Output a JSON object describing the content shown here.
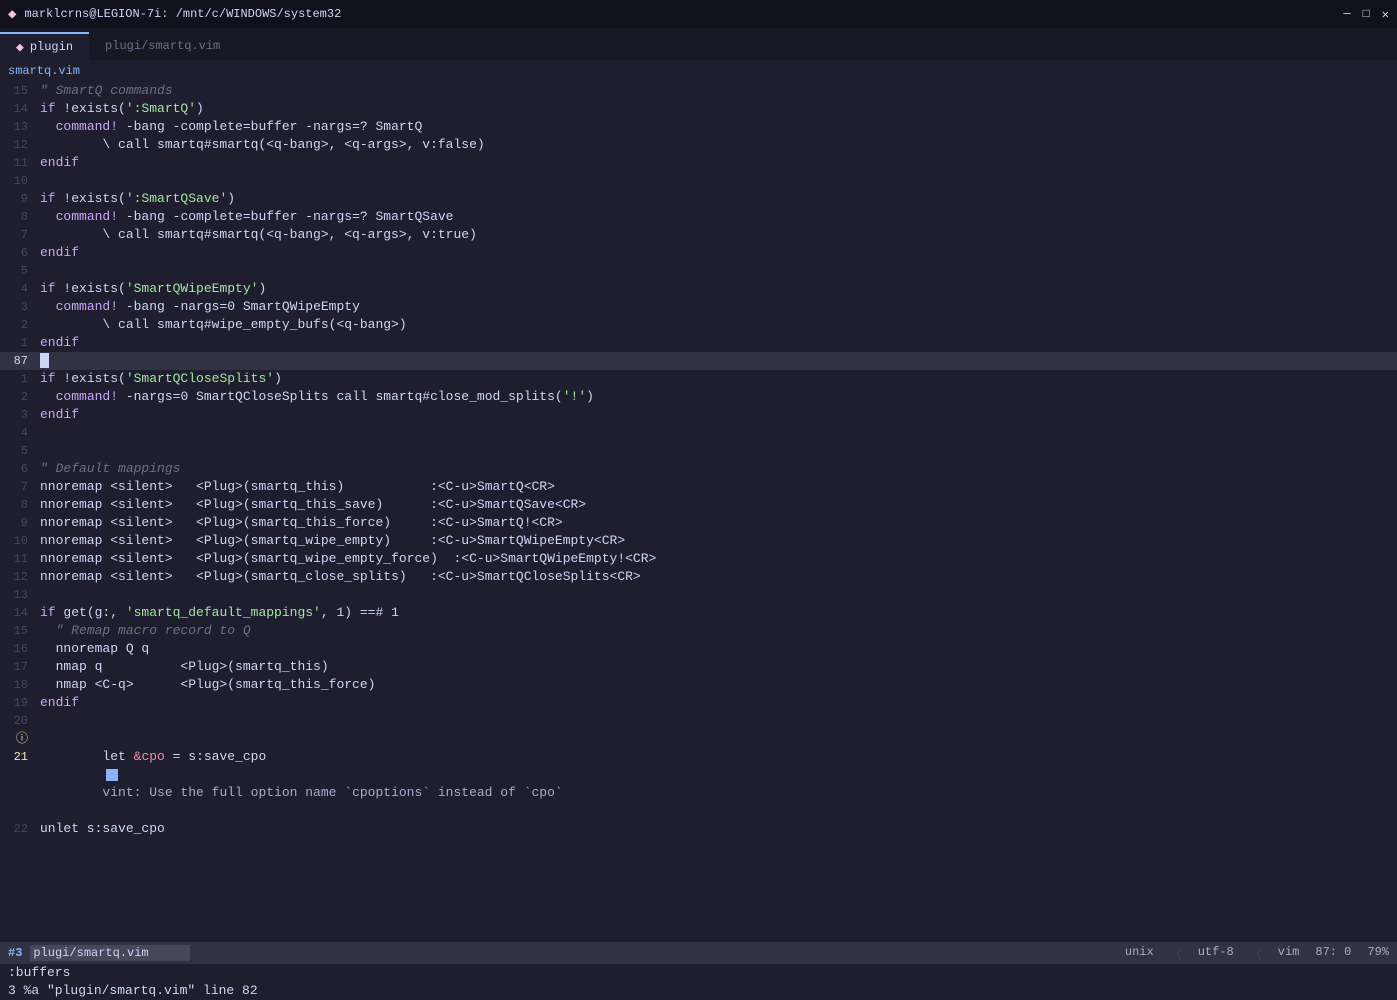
{
  "titlebar": {
    "title": "marklcrns@LEGION-7i: /mnt/c/WINDOWS/system32",
    "icon": "◆",
    "minimize": "─",
    "maximize": "□",
    "close": "✕"
  },
  "tabs": [
    {
      "label": "plugin",
      "icon": "◆",
      "active": true
    },
    {
      "label": "plugi/smartq.vim",
      "icon": "",
      "active": false
    }
  ],
  "filename": "smartq.vim",
  "status_bar": {
    "mode": "#3",
    "file": "plugi/smartq.vim",
    "unix": "unix",
    "encoding": "utf-8",
    "filetype": "vim",
    "position": "87: 0",
    "percent": "79%"
  },
  "cmdline": {
    "buffers_label": ":buffers",
    "buf_line": "  3 %a    \"plugin/smartq.vim\"             line 82"
  },
  "warning_line": {
    "text": "● vint: Use the full option name `cpoptions` instead of `cpo`"
  },
  "lines": [
    {
      "num": "15",
      "content": "\" <span class=\"cm\"> SmartQ commands</span>"
    },
    {
      "num": "14",
      "content": "<span class=\"kw\">if</span> !exists(<span class=\"str\">':SmartQ'</span>)"
    },
    {
      "num": "13",
      "content": "  <span class=\"kw\">command!</span> -bang -complete=buffer -nargs=? SmartQ"
    },
    {
      "num": "12",
      "content": "        \\ call smartq#smartq(&lt;q-bang&gt;, &lt;q-args&gt;, v:false)"
    },
    {
      "num": "11",
      "content": "<span class=\"kw\">endif</span>"
    },
    {
      "num": "10",
      "content": ""
    },
    {
      "num": "9",
      "content": "<span class=\"kw\">if</span> !exists(<span class=\"str\">':SmartQSave'</span>)"
    },
    {
      "num": "8",
      "content": "  <span class=\"kw\">command!</span> -bang -complete=buffer -nargs=? SmartQSave"
    },
    {
      "num": "7",
      "content": "        \\ call smartq#smartq(&lt;q-bang&gt;, &lt;q-args&gt;, v:true)"
    },
    {
      "num": "6",
      "content": "<span class=\"kw\">endif</span>"
    },
    {
      "num": "5",
      "content": ""
    },
    {
      "num": "4",
      "content": "<span class=\"kw\">if</span> !exists(<span class=\"str\">'SmartQWipeEmpty'</span>)"
    },
    {
      "num": "3",
      "content": "  <span class=\"kw\">command!</span> -bang -nargs=0 SmartQWipeEmpty"
    },
    {
      "num": "2",
      "content": "        \\ call smartq#wipe_empty_bufs(&lt;q-bang&gt;)"
    },
    {
      "num": "1",
      "content": "<span class=\"kw\">endif</span>"
    }
  ],
  "current_line": {
    "num": "87",
    "content": ""
  },
  "lines_after": [
    {
      "num": "1",
      "content": "<span class=\"kw\">if</span> !exists(<span class=\"str\">'SmartQCloseSplits'</span>)"
    },
    {
      "num": "2",
      "content": "  <span class=\"kw\">command!</span> -nargs=0 SmartQCloseSplits call smartq#close_mod_splits(<span class=\"str\">'!'</span>)"
    },
    {
      "num": "3",
      "content": "<span class=\"kw\">endif</span>"
    },
    {
      "num": "4",
      "content": ""
    },
    {
      "num": "5",
      "content": ""
    },
    {
      "num": "6",
      "content": "<span class=\"cm\">\" Default mappings</span>"
    },
    {
      "num": "7",
      "content": "nnoremap &lt;silent&gt;   &lt;Plug&gt;(smartq_this)           :&lt;C-u&gt;SmartQ&lt;CR&gt;"
    },
    {
      "num": "8",
      "content": "nnoremap &lt;silent&gt;   &lt;Plug&gt;(smartq_this_save)      :&lt;C-u&gt;SmartQSave&lt;CR&gt;"
    },
    {
      "num": "9",
      "content": "nnoremap &lt;silent&gt;   &lt;Plug&gt;(smartq_this_force)     :&lt;C-u&gt;SmartQ!&lt;CR&gt;"
    },
    {
      "num": "10",
      "content": "nnoremap &lt;silent&gt;   &lt;Plug&gt;(smartq_wipe_empty)     :&lt;C-u&gt;SmartQWipeEmpty&lt;CR&gt;"
    },
    {
      "num": "11",
      "content": "nnoremap &lt;silent&gt;   &lt;Plug&gt;(smartq_wipe_empty_force) :&lt;C-u&gt;SmartQWipeEmpty!&lt;CR&gt;"
    },
    {
      "num": "12",
      "content": "nnoremap &lt;silent&gt;   &lt;Plug&gt;(smartq_close_splits)   :&lt;C-u&gt;SmartQCloseSplits&lt;CR&gt;"
    },
    {
      "num": "13",
      "content": ""
    },
    {
      "num": "14",
      "content": "<span class=\"kw\">if</span> get(g:, <span class=\"str\">'smartq_default_mappings'</span>, 1) ==# 1"
    },
    {
      "num": "15",
      "content": "  <span class=\"cm\">\" Remap macro record to Q</span>"
    },
    {
      "num": "16",
      "content": "  nnoremap Q q"
    },
    {
      "num": "17",
      "content": "  nmap q          &lt;Plug&gt;(smartq_this)"
    },
    {
      "num": "18",
      "content": "  nmap &lt;C-q&gt;      &lt;Plug&gt;(smartq_this_force)"
    },
    {
      "num": "19",
      "content": "<span class=\"kw\">endif</span>"
    },
    {
      "num": "20",
      "content": ""
    }
  ]
}
